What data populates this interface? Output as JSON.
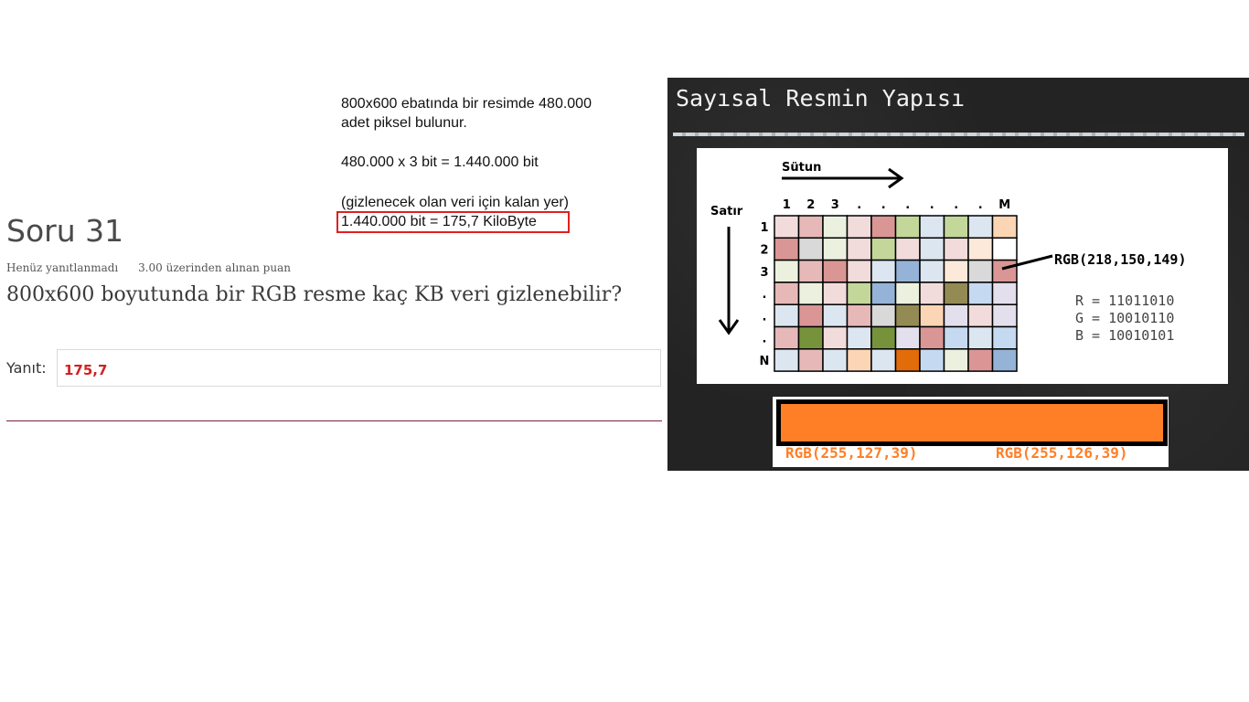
{
  "question": {
    "title": "Soru 31",
    "status": "Henüz yanıtlanmadı",
    "grade": "3.00 üzerinden alınan puan",
    "text": "800x600 boyutunda bir RGB resme kaç KB veri gizlenebilir?",
    "answer_label": "Yanıt:",
    "answer_value": "175,7",
    "answer_color": "#d22020",
    "divider_color": "#7a1f3d"
  },
  "calculation": {
    "line1": "800x600 ebatında bir resimde 480.000",
    "line2": "adet piksel bulunur.",
    "line3": "480.000 x 3 bit = 1.440.000 bit",
    "line4": "(gizlenecek olan veri için kalan yer)",
    "line5": "1.440.000 bit = 175,7 KiloByte",
    "highlight_color": "#e02020"
  },
  "slide": {
    "title": "Sayısal Resmin Yapısı",
    "column_label": "Sütun",
    "row_label": "Satır",
    "column_headers": [
      "1",
      "2",
      "3",
      ".",
      ".",
      ".",
      ".",
      ".",
      ".",
      "M"
    ],
    "row_headers": [
      "1",
      "2",
      "3",
      ".",
      ".",
      ".",
      "N"
    ],
    "pixel_colors": [
      [
        "#f2dcdb",
        "#e6b9b8",
        "#ebf1de",
        "#f2dcdb",
        "#da9694",
        "#c4d79b",
        "#dce6f1",
        "#c4d79b",
        "#dce6f1",
        "#fcd5b4"
      ],
      [
        "#da9694",
        "#d9d9d9",
        "#ebf1de",
        "#f2dcdb",
        "#c4d79b",
        "#f2dcdb",
        "#dce6f1",
        "#f2dcdb",
        "#fde9d9",
        "#ffffff"
      ],
      [
        "#ebf1de",
        "#e6b9b8",
        "#da9694",
        "#f2dcdb",
        "#dce6f1",
        "#95b3d7",
        "#dce6f1",
        "#fde9d9",
        "#d9d9d9",
        "#da9694"
      ],
      [
        "#e6b9b8",
        "#ebf1de",
        "#f2dcdb",
        "#c4d79b",
        "#95b3d7",
        "#ebf1de",
        "#f2dcdb",
        "#948a54",
        "#c5d9f1",
        "#e4dfec"
      ],
      [
        "#dce6f1",
        "#da9694",
        "#dce6f1",
        "#e6b9b8",
        "#d9d9d9",
        "#948a54",
        "#fcd5b4",
        "#e4dfec",
        "#f2dcdb",
        "#e4dfec"
      ],
      [
        "#e6b9b8",
        "#76933c",
        "#f2dcdb",
        "#dce6f1",
        "#76933c",
        "#e4dfec",
        "#da9694",
        "#c5d9f1",
        "#dce6f1",
        "#c5d9f1"
      ],
      [
        "#dce6f1",
        "#e6b9b8",
        "#dce6f1",
        "#fcd5b4",
        "#dce6f1",
        "#e26b0a",
        "#c5d9f1",
        "#ebf1de",
        "#da9694",
        "#95b3d7"
      ]
    ],
    "rgb_label": "RGB(218,150,149)",
    "binary_r": "R = 11011010",
    "binary_g": "G = 10010110",
    "binary_b": "B = 10010101",
    "orange_left": "RGB(255,127,39)",
    "orange_right": "RGB(255,126,39)",
    "orange_color": "#ff7f27"
  }
}
